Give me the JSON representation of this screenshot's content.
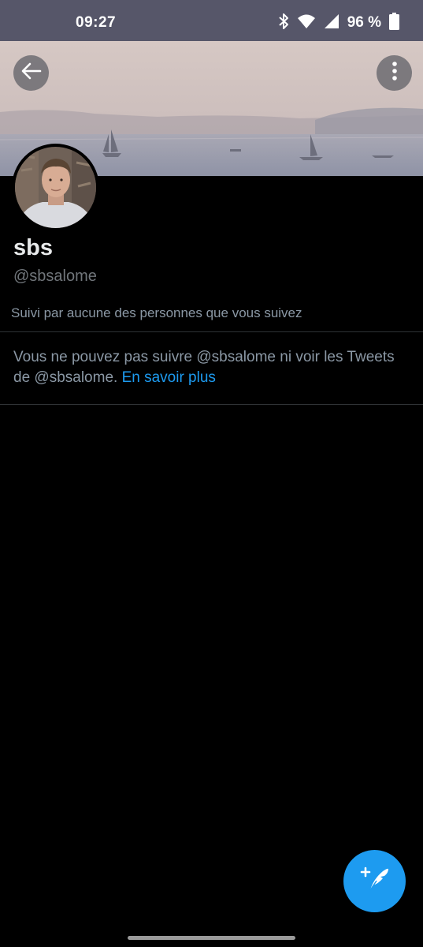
{
  "status_bar": {
    "time": "09:27",
    "battery_percent": "96 %",
    "icons": [
      "bluetooth-icon",
      "wifi-icon",
      "signal-icon",
      "battery-icon"
    ]
  },
  "header": {
    "back_icon": "arrow-left-icon",
    "more_icon": "more-vertical-icon"
  },
  "profile": {
    "display_name": "sbs",
    "handle": "@sbsalome",
    "followed_by": "Suivi par aucune des personnes que vous suivez"
  },
  "protected_notice": {
    "text_prefix": "Vous ne pouvez pas suivre @sbsalome ni voir les Tweets de @sbsalome. ",
    "learn_more_label": "En savoir plus"
  },
  "fab": {
    "icon": "compose-tweet-icon"
  },
  "colors": {
    "status_bar": "#565669",
    "background": "#000000",
    "accent": "#1d9bf0",
    "secondary_text": "#8b98a5",
    "divider": "#2f3336"
  }
}
